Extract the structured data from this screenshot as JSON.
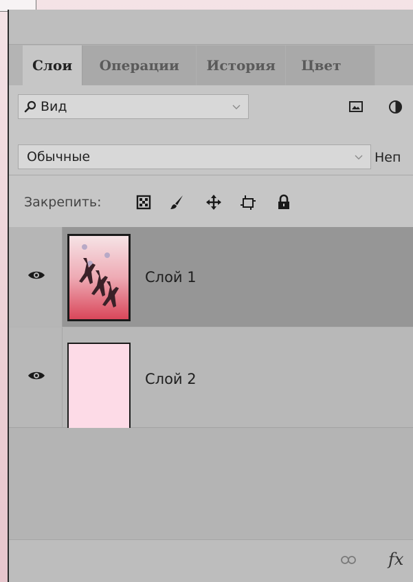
{
  "tabs": [
    {
      "label": "Слои",
      "active": true
    },
    {
      "label": "Операции",
      "active": false
    },
    {
      "label": "История",
      "active": false
    },
    {
      "label": "Цвет",
      "active": false
    }
  ],
  "filter": {
    "label": "Вид",
    "icons": [
      "search-icon",
      "image-filter-icon",
      "adjustment-filter-icon"
    ]
  },
  "blend": {
    "mode": "Обычные",
    "opacity_label": "Неп"
  },
  "lock": {
    "label": "Закрепить:",
    "icons": [
      "lock-transparent-pixels-icon",
      "lock-image-pixels-icon",
      "lock-position-icon",
      "lock-artboard-icon",
      "lock-all-icon"
    ]
  },
  "layers": [
    {
      "name": "Слой 1",
      "selected": true,
      "visible": true
    },
    {
      "name": "Слой 2",
      "selected": false,
      "visible": true
    }
  ],
  "bottom": {
    "icons": [
      "link-layers-icon",
      "fx-icon"
    ],
    "fx_label": "fx"
  },
  "colors": {
    "panel": "#b4b4b4",
    "selected_row": "#969696",
    "layer2_fill": "#fddbe7"
  }
}
